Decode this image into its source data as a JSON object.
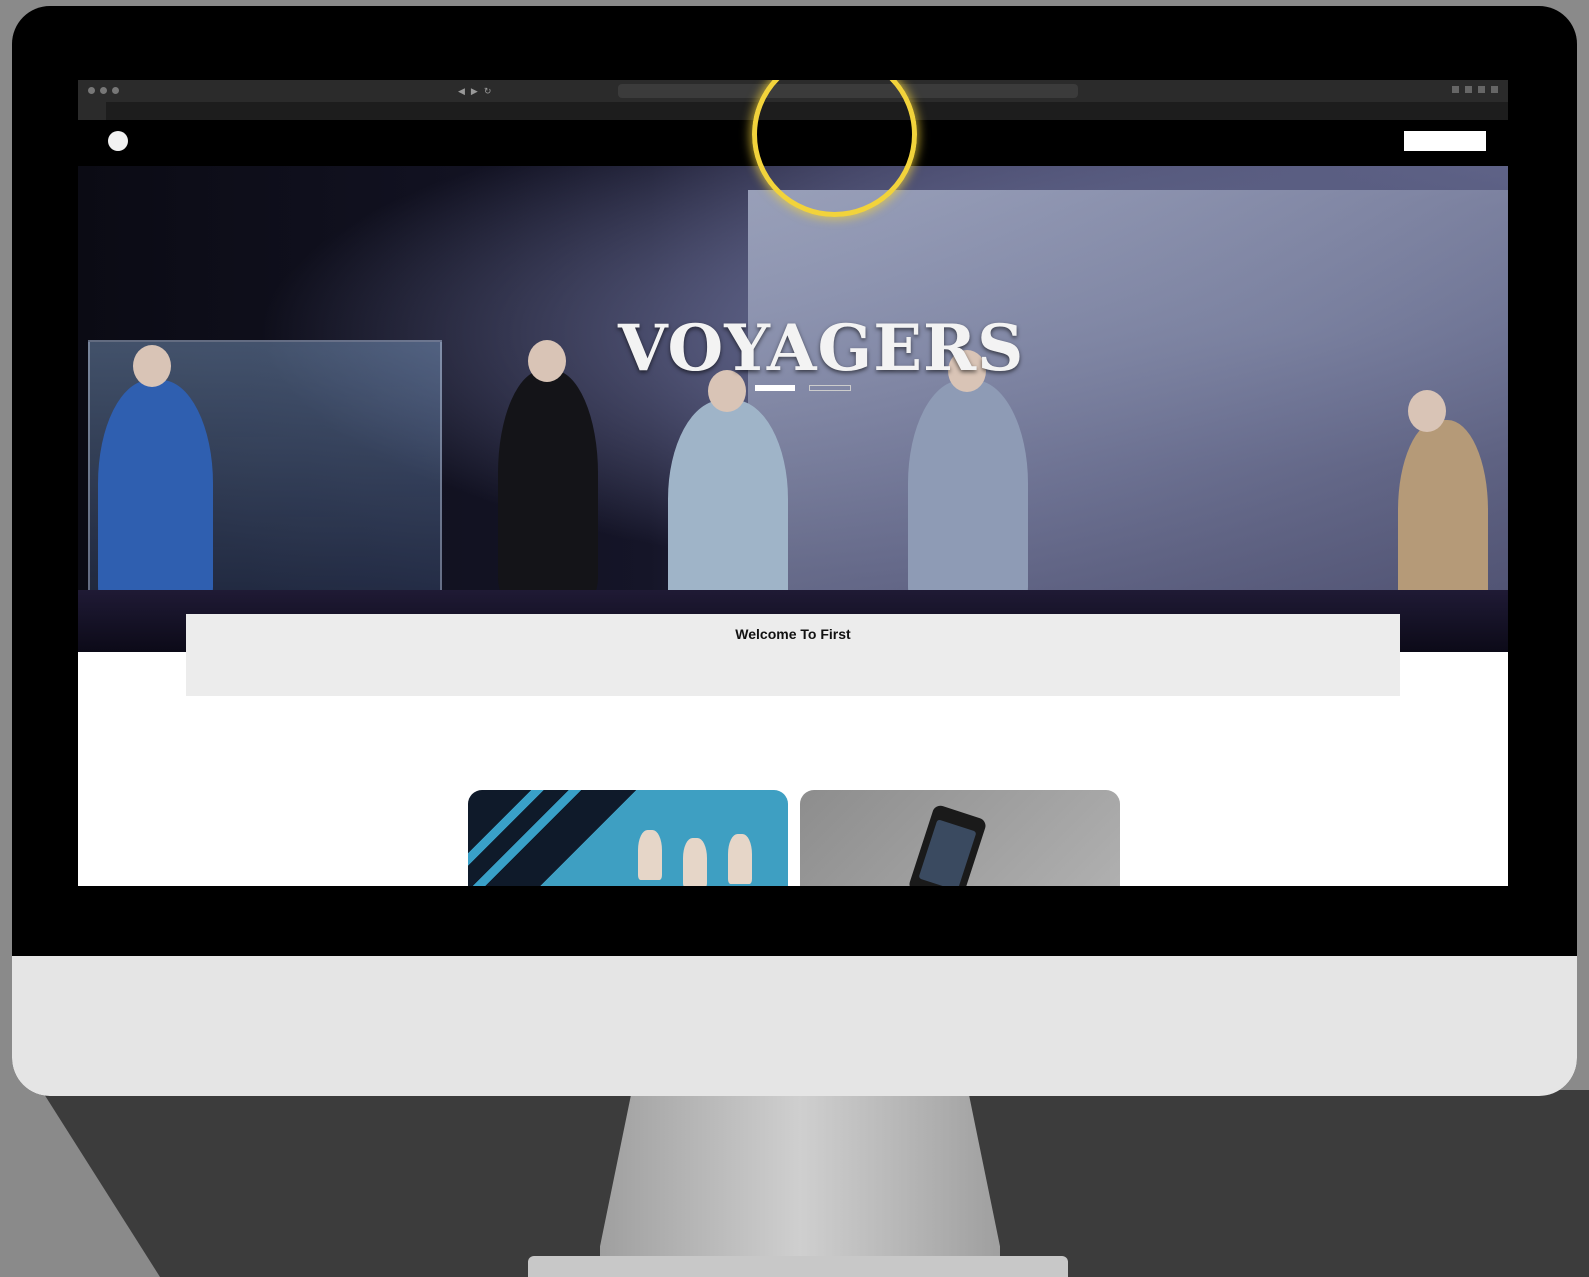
{
  "browser": {
    "url": "",
    "tabs": [
      "",
      "",
      ""
    ]
  },
  "site": {
    "menu": [
      "",
      "",
      "",
      "",
      "",
      ""
    ],
    "cta_label": ""
  },
  "hero": {
    "kicker": "",
    "title": "VOYAGERS",
    "tag_left": "",
    "tag_right": ""
  },
  "welcome": {
    "title": "Welcome To First",
    "body": ""
  },
  "colors": {
    "highlight": "#f2d33b",
    "nav_bg": "#000000",
    "welcome_bg": "#ececec"
  },
  "icons": [
    "logo-icon"
  ]
}
